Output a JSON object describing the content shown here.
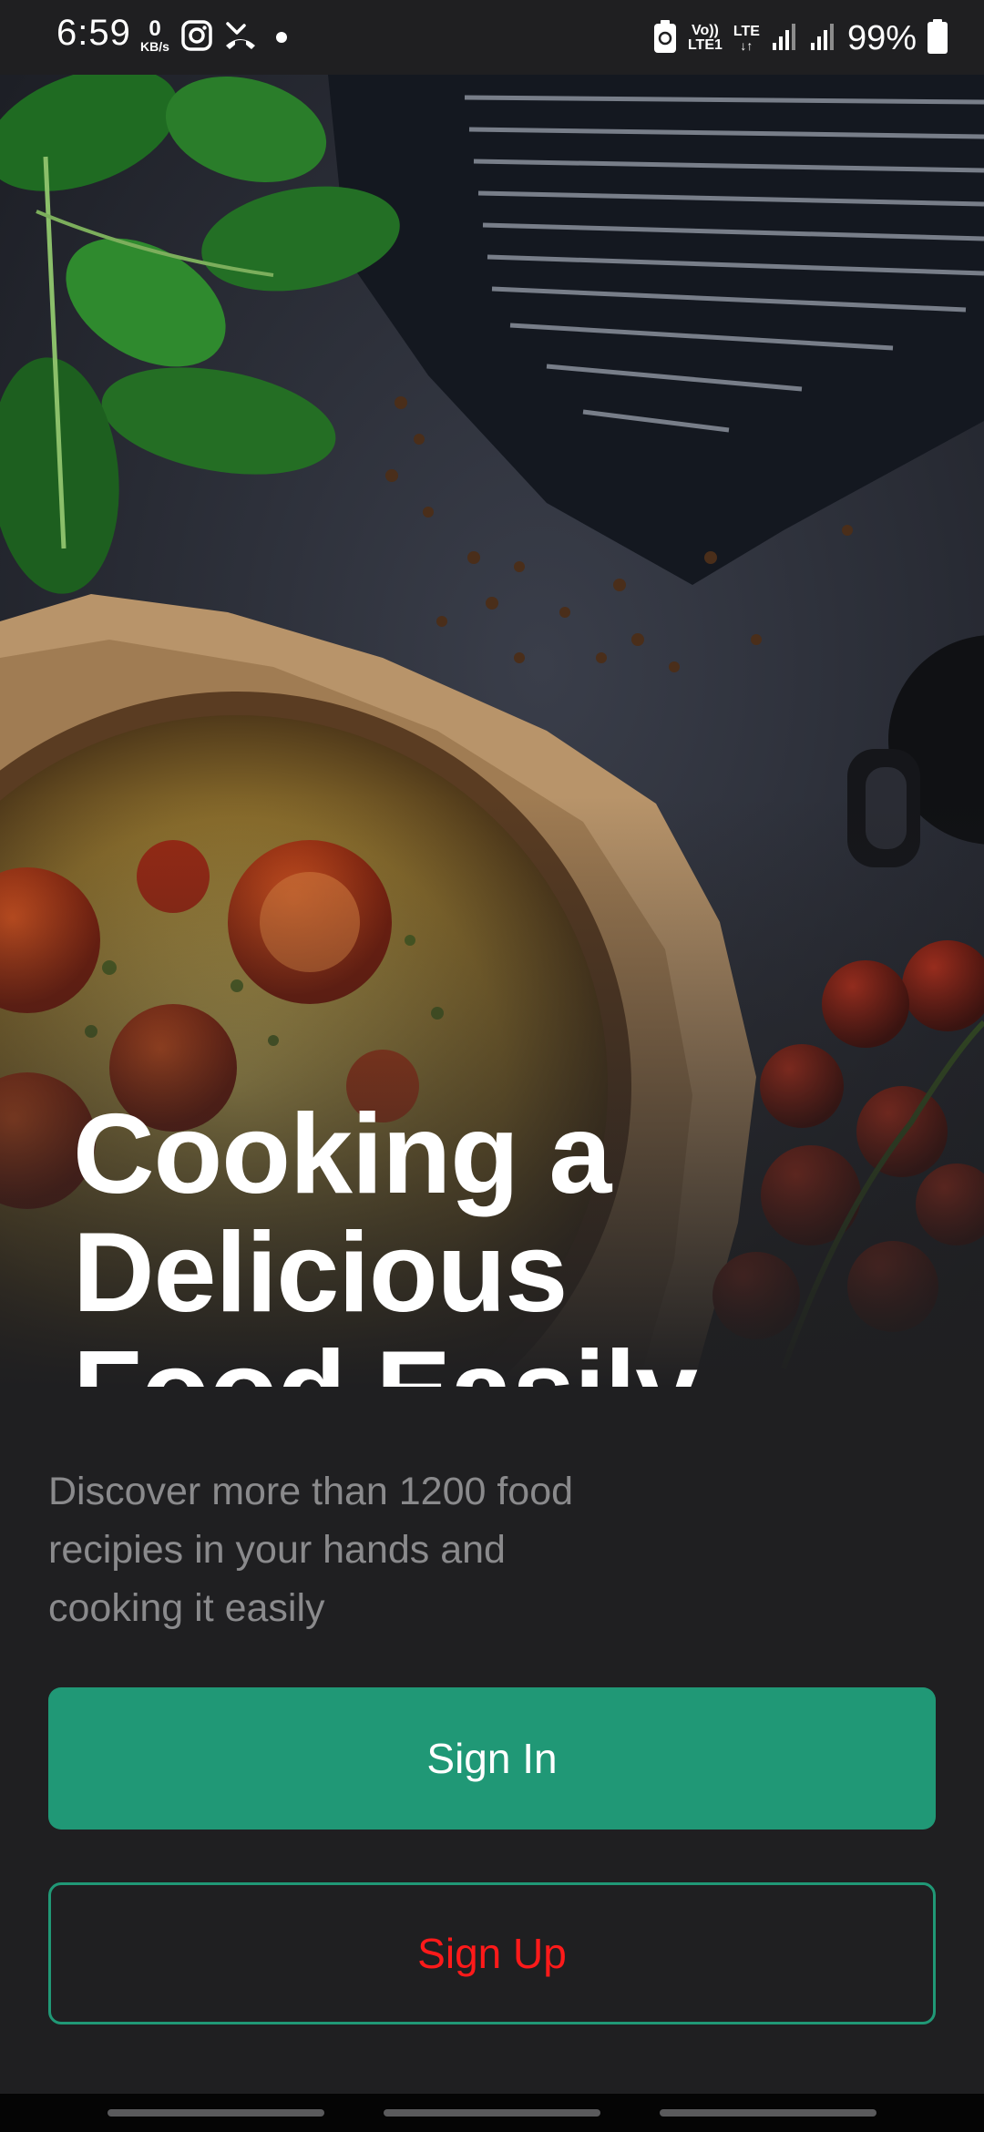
{
  "status_bar": {
    "time": "6:59",
    "net_speed_value": "0",
    "net_speed_unit": "KB/s",
    "volte": "Vo))",
    "volte_sub": "LTE1",
    "lte": "LTE",
    "battery": "99%",
    "icons": [
      "instagram-icon",
      "missed-call-icon",
      "notification-dot",
      "battery-saver-icon",
      "signal-icon",
      "signal-icon",
      "battery-icon"
    ]
  },
  "hero": {
    "headline_lines": [
      "Cooking a",
      "Delicious",
      "Food Easily"
    ],
    "image": "food-hero-image"
  },
  "subtitle_lines": [
    "Discover more than 1200 food",
    "recipies in your hands and",
    "cooking it easily"
  ],
  "buttons": {
    "sign_in": "Sign In",
    "sign_up": "Sign Up"
  },
  "colors": {
    "background": "#1f1f21",
    "accent": "#209876",
    "sign_up_text": "#ff1a1a",
    "subtitle": "#8a8a8c"
  }
}
